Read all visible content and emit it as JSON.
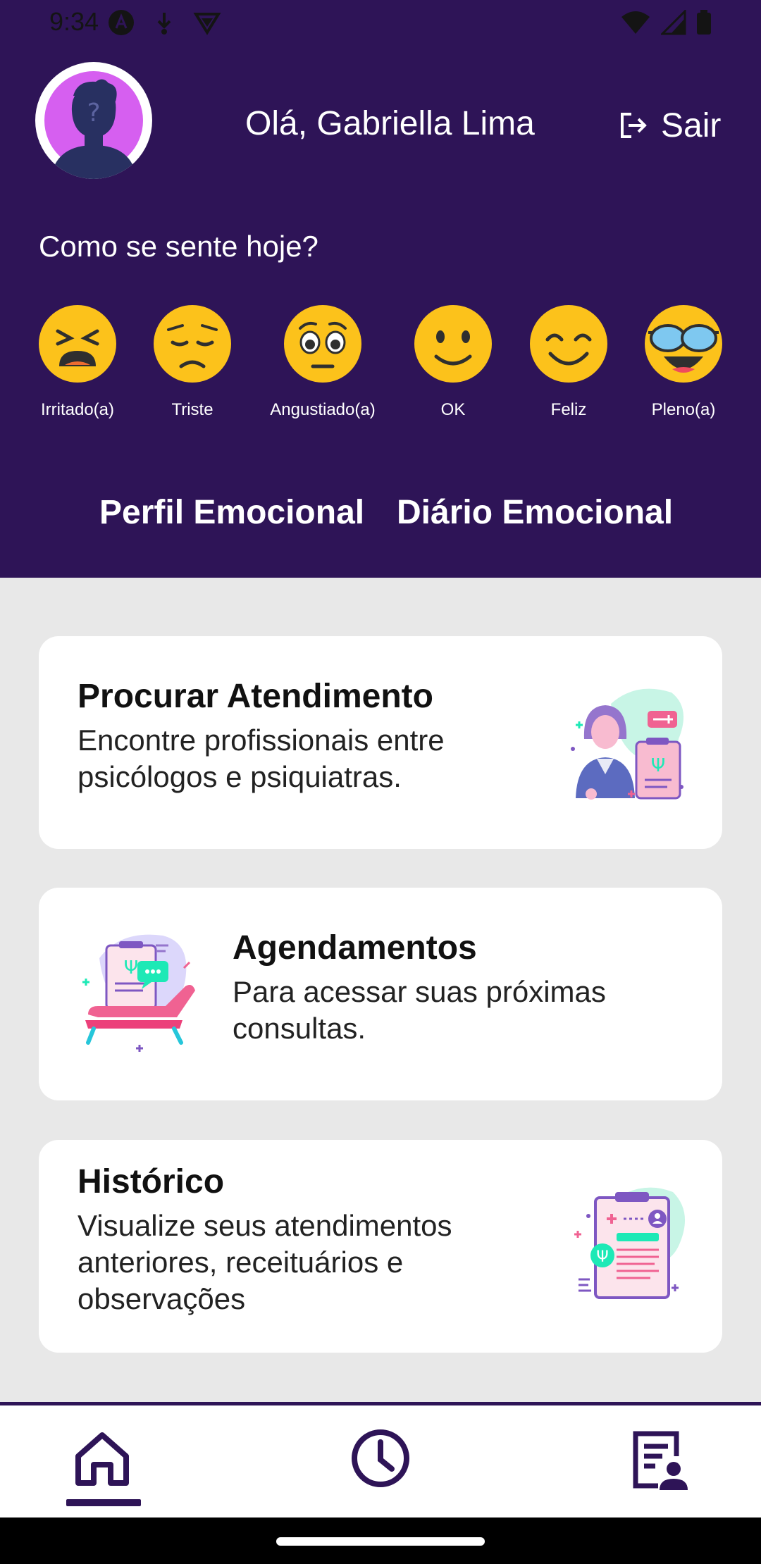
{
  "status_bar": {
    "time": "9:34"
  },
  "header": {
    "greeting": "Olá, Gabriella Lima",
    "logout_label": "Sair",
    "mood_question": "Como se sente hoje?",
    "moods": [
      {
        "label": "Irritado(a)",
        "icon": "angry-face-icon"
      },
      {
        "label": "Triste",
        "icon": "sad-face-icon"
      },
      {
        "label": "Angustiado(a)",
        "icon": "anxious-face-icon"
      },
      {
        "label": "OK",
        "icon": "slight-smile-face-icon"
      },
      {
        "label": "Feliz",
        "icon": "happy-face-icon"
      },
      {
        "label": "Pleno(a)",
        "icon": "cool-face-icon"
      }
    ],
    "tabs": [
      {
        "label": "Perfil Emocional"
      },
      {
        "label": "Diário Emocional"
      }
    ]
  },
  "cards": [
    {
      "title": "Procurar Atendimento",
      "description": "Encontre profissionais entre psicólogos e psiquiatras."
    },
    {
      "title": "Agendamentos",
      "description": "Para acessar suas próximas consultas."
    },
    {
      "title": "Histórico",
      "description": "Visualize seus atendimentos anteriores, receituários e observações"
    }
  ],
  "bottom_nav": [
    {
      "name": "home-icon",
      "active": true
    },
    {
      "name": "clock-icon",
      "active": false
    },
    {
      "name": "records-icon",
      "active": false
    }
  ],
  "colors": {
    "primary": "#2e1457",
    "emoji_yellow": "#fcc21b",
    "accent_pink": "#f06292",
    "accent_green": "#1de9b6",
    "background": "#e8e8e8"
  }
}
